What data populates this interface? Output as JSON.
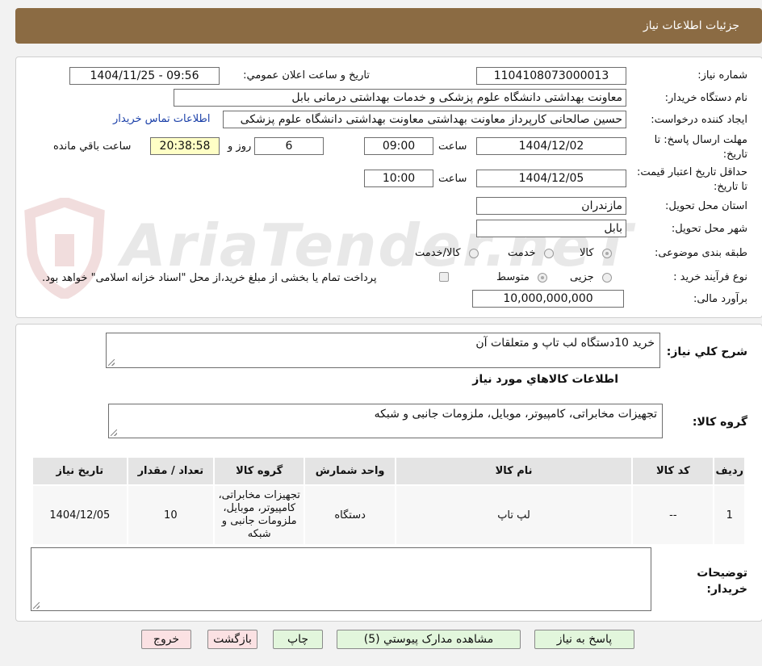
{
  "header": {
    "title": "جزئیات اطلاعات نیاز"
  },
  "watermark": {
    "text": "AriaTender.neT"
  },
  "form": {
    "need_number_label": "شماره نیاز:",
    "need_number": "1104108073000013",
    "announce_label": "تاريخ و ساعت اعلان عمومي:",
    "announce_value": "1404/11/25 - 09:56",
    "buyer_org_label": "نام دستگاه خریدار:",
    "buyer_org": "معاونت بهداشتی دانشگاه علوم پزشکی و خدمات بهداشتی درمانی بابل",
    "creator_label": "ایجاد کننده درخواست:",
    "creator": "حسین صالحانی کارپرداز معاونت بهداشتی معاونت بهداشتی دانشگاه علوم پزشکی",
    "contact_link": "اطلاعات تماس خریدار",
    "deadline_label": "مهلت ارسال پاسخ: تا تاریخ:",
    "deadline_date": "1404/12/02",
    "time_label": "ساعت",
    "deadline_time": "09:00",
    "days": "6",
    "days_and": "روز و",
    "remaining_time": "20:38:58",
    "remaining_label": "ساعت باقي مانده",
    "validity_label": "حداقل تاریخ اعتبار قیمت: تا تاریخ:",
    "validity_date": "1404/12/05",
    "validity_time": "10:00",
    "province_label": "استان محل تحویل:",
    "province": "مازندران",
    "city_label": "شهر محل تحویل:",
    "city": "بابل",
    "category_label": "طبقه بندی موضوعی:",
    "category_options": [
      "کالا",
      "خدمت",
      "کالا/خدمت"
    ],
    "process_label": "نوع فرآیند خرید :",
    "process_options": [
      "جزیی",
      "متوسط"
    ],
    "payment_note": "پرداخت تمام یا بخشی از مبلغ خرید،از محل \"اسناد خزانه اسلامی\" خواهد بود.",
    "budget_label": "برآورد مالی:",
    "budget": "10,000,000,000"
  },
  "summary": {
    "general_label": "شرح كلي نياز:",
    "general_value": "خرید 10دستگاه لب تاپ و متعلقات آن",
    "goods_info_title": "اطلاعات كالاهاي مورد نياز",
    "goods_group_label": "گروه کالا:",
    "goods_group_value": "تجهیزات مخابراتی، کامپیوتر، موبایل، ملزومات جانبی و شبکه"
  },
  "table": {
    "headers": [
      "رديف",
      "کد کالا",
      "نام کالا",
      "واحد شمارش",
      "گروه کالا",
      "تعداد / مقدار",
      "تاریخ نیاز"
    ],
    "rows": [
      [
        "1",
        "--",
        "لپ تاپ",
        "دستگاه",
        "تجهیزات مخابراتی، کامپیوتر، موبایل، ملزومات جانبی و شبکه",
        "10",
        "1404/12/05"
      ]
    ]
  },
  "notes": {
    "label": "توضیحات خریدار:",
    "value": ""
  },
  "buttons": {
    "reply": "پاسخ به نیاز",
    "attachments": "مشاهده مدارک پیوستي (5)",
    "print": "چاپ",
    "back": "بازگشت",
    "exit": "خروج"
  },
  "colors": {
    "header": "#8b6b43",
    "green_button": "#e2f6dc",
    "pink_button": "#fbe1e3",
    "remaining": "#ffffc6"
  }
}
